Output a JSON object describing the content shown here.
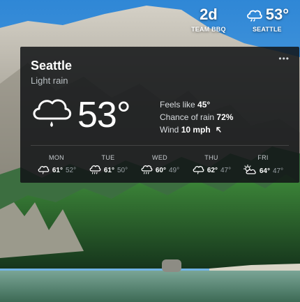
{
  "topbar": {
    "todo": {
      "value": "2d",
      "label": "TEAM BBQ"
    },
    "weather": {
      "value": "53°",
      "label": "SEATTLE",
      "icon": "cloud-icon"
    }
  },
  "card": {
    "more_label": "•••",
    "city": "Seattle",
    "condition": "Light rain",
    "temperature": "53°",
    "feels_like_label": "Feels like",
    "feels_like_value": "45°",
    "rain_label": "Chance of rain",
    "rain_value": "72%",
    "wind_label": "Wind",
    "wind_value": "10 mph",
    "forecast": [
      {
        "day": "MON",
        "hi": "61°",
        "lo": "52°",
        "icon": "cloud-icon"
      },
      {
        "day": "TUE",
        "hi": "61°",
        "lo": "50°",
        "icon": "rain-cloud-icon"
      },
      {
        "day": "WED",
        "hi": "60°",
        "lo": "49°",
        "icon": "rain-cloud-icon"
      },
      {
        "day": "THU",
        "hi": "62°",
        "lo": "47°",
        "icon": "cloud-icon"
      },
      {
        "day": "FRI",
        "hi": "64°",
        "lo": "47°",
        "icon": "partly-sunny-icon"
      }
    ]
  },
  "colors": {
    "card_bg": "#121416",
    "text_primary": "#ffffff",
    "text_secondary": "#b9bfc3"
  }
}
